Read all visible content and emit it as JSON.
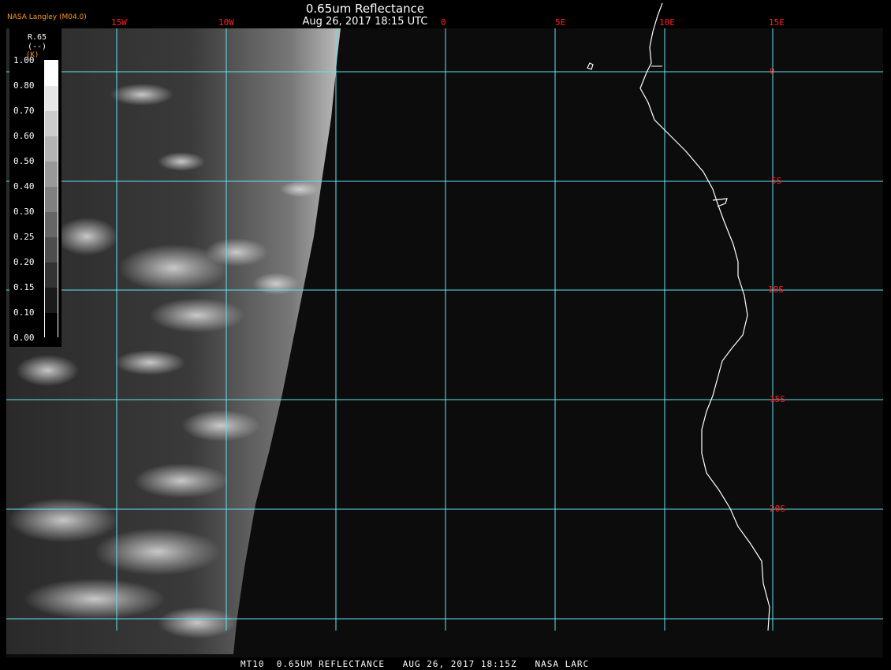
{
  "title": "0.65um Reflectance",
  "subtitle": "Aug 26, 2017 18:15 UTC",
  "org": "NASA Langley (M04.0)",
  "longitude_labels": [
    "15W",
    "10W",
    "0",
    "5E",
    "10E",
    "15E"
  ],
  "latitude_labels": [
    "0",
    "5S",
    "10S",
    "15S",
    "20S"
  ],
  "legend": {
    "variable": "R.65",
    "units": "(--)",
    "scale_tag": "(K)",
    "ticks": [
      "1.00",
      "0.80",
      "0.70",
      "0.60",
      "0.50",
      "0.40",
      "0.30",
      "0.25",
      "0.20",
      "0.15",
      "0.10",
      "0.00"
    ]
  },
  "footer": "MT10  0.65UM REFLECTANCE   AUG 26, 2017 18:15Z   NASA LARC",
  "colors": {
    "grid": "#5ee6f0",
    "coastline": "#ffffff",
    "labels": "#ff2020",
    "org": "#ff9a1e",
    "background": "#0c0c0c"
  }
}
